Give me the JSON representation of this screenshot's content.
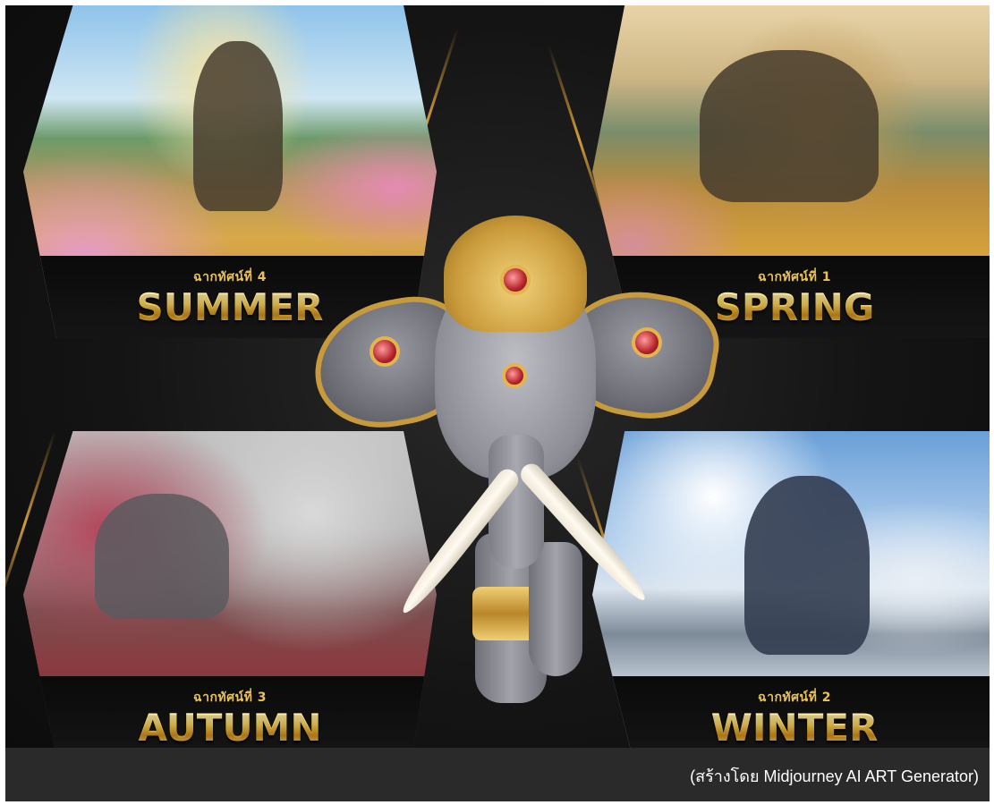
{
  "panels": {
    "summer": {
      "subtitle": "ฉากทัศน์ที่ 4",
      "title": "SUMMER"
    },
    "spring": {
      "subtitle": "ฉากทัศน์ที่ 1",
      "title": "SPRING"
    },
    "autumn": {
      "subtitle": "ฉากทัศน์ที่ 3",
      "title": "AUTUMN"
    },
    "winter": {
      "subtitle": "ฉากทัศน์ที่ 2",
      "title": "WINTER"
    }
  },
  "caption": "(สร้างโดย  Midjourney AI ART Generator)",
  "colors": {
    "background": "#111111",
    "gold": "#e9c25a",
    "caption_bar": "#2a2a2a"
  }
}
